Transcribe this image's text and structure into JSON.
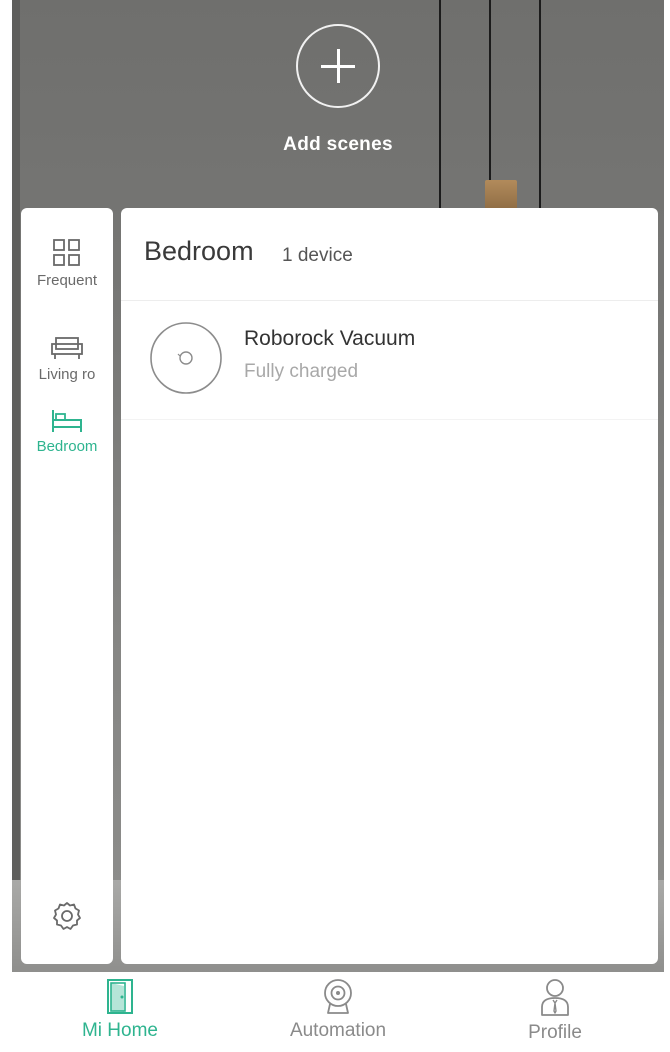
{
  "scenes": {
    "add_label": "Add scenes"
  },
  "sidebar": {
    "rooms": [
      {
        "label": "Frequent",
        "icon": "grid-icon",
        "active": false
      },
      {
        "label": "Living ro",
        "icon": "sofa-icon",
        "active": false
      },
      {
        "label": "Bedroom",
        "icon": "bed-icon",
        "active": true
      }
    ],
    "settings_icon": "gear-icon"
  },
  "room": {
    "title": "Bedroom",
    "device_count": "1 device"
  },
  "devices": [
    {
      "name": "Roborock Vacuum",
      "status": "Fully charged",
      "icon": "robot-vacuum-icon"
    }
  ],
  "bottom_nav": [
    {
      "label": "Mi Home",
      "icon": "home-door-icon",
      "active": true
    },
    {
      "label": "Automation",
      "icon": "automation-icon",
      "active": false
    },
    {
      "label": "Profile",
      "icon": "profile-icon",
      "active": false
    }
  ],
  "colors": {
    "accent": "#2eb48f",
    "inactive": "#8a8a8a",
    "panel_bg": "#ffffff"
  }
}
